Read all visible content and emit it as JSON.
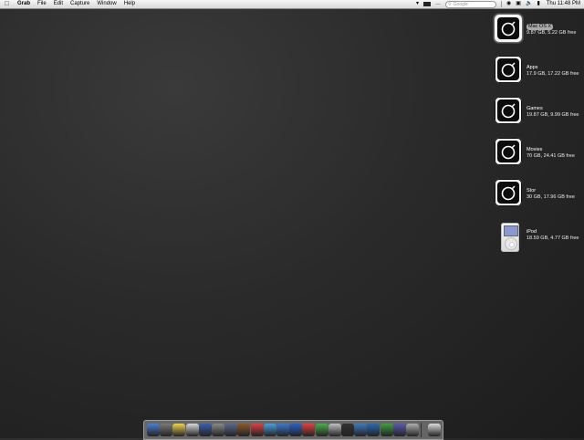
{
  "menubar": {
    "apple": "",
    "app_name": "Grab",
    "menus": [
      "File",
      "Edit",
      "Capture",
      "Window",
      "Help"
    ],
    "search_placeholder": "Google",
    "clock": "Thu 11:48 PM"
  },
  "desktop_icons": [
    {
      "name": "Mac OS X",
      "info": "9.87 GB, 5.22 GB free",
      "selected": true
    },
    {
      "name": "Apps",
      "info": "17.9 GB, 17.22 GB free"
    },
    {
      "name": "Games",
      "info": "19.87 GB, 9.99 GB free"
    },
    {
      "name": "Movies",
      "info": "70 GB, 24.41 GB free"
    },
    {
      "name": "Stor",
      "info": "30 GB, 17.96 GB free"
    },
    {
      "name": "iPod",
      "info": "18.59 GB, 4.77 GB free"
    }
  ],
  "dock": {
    "items": [
      {
        "icon": "finder-icon",
        "color": "#4a7fd4"
      },
      {
        "icon": "calculator-icon",
        "color": "#7a7a7a"
      },
      {
        "icon": "stickies-icon",
        "color": "#f2d64a"
      },
      {
        "icon": "textedit-icon",
        "color": "#d9d9d9"
      },
      {
        "icon": "pen-icon",
        "color": "#3a5fb0"
      },
      {
        "icon": "system-prefs-icon",
        "color": "#8a8a8a"
      },
      {
        "icon": "tools-icon",
        "color": "#5a6a8a"
      },
      {
        "icon": "addressbook-icon",
        "color": "#8b5a2b"
      },
      {
        "icon": "ical-icon",
        "color": "#e04040"
      },
      {
        "icon": "safari-icon",
        "color": "#4aa0e0"
      },
      {
        "icon": "mail-icon",
        "color": "#3a7ad0"
      },
      {
        "icon": "itunes-icon",
        "color": "#2b60c8"
      },
      {
        "icon": "bluetooth-icon",
        "color": "#e34040"
      },
      {
        "icon": "ichat-icon",
        "color": "#4ab04a"
      },
      {
        "icon": "dvd-icon",
        "color": "#c0c0c0"
      },
      {
        "icon": "console-icon",
        "color": "#333333"
      },
      {
        "icon": "photo-icon",
        "color": "#3c7ac0"
      },
      {
        "icon": "utility-icon",
        "color": "#2a6ab0"
      },
      {
        "icon": "activity-icon",
        "color": "#40a040"
      },
      {
        "icon": "network-icon",
        "color": "#5a5ab0"
      },
      {
        "icon": "window-icon",
        "color": "#b0b0b0"
      },
      {
        "icon": "trash-icon",
        "color": "#dcdcdc"
      }
    ]
  }
}
